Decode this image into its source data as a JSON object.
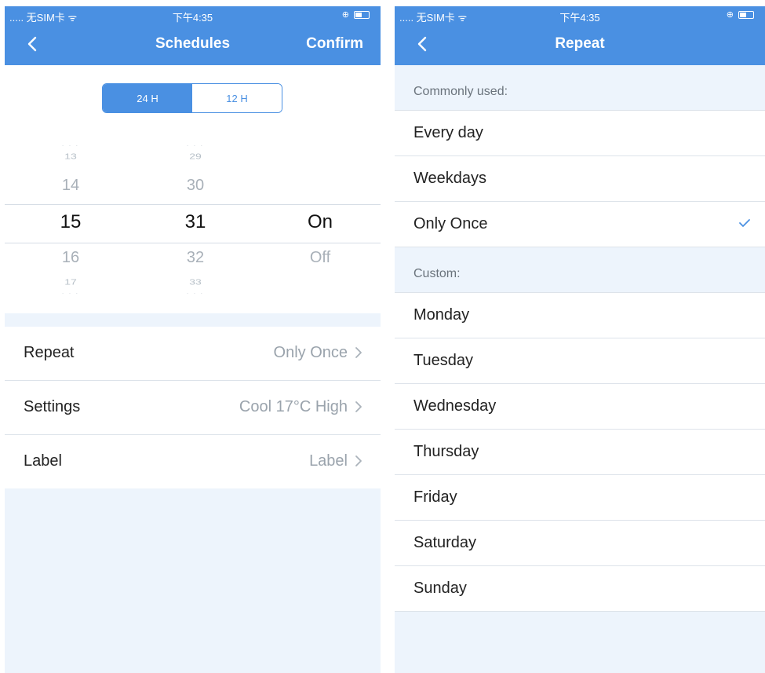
{
  "left": {
    "status": {
      "carrier": "..... 无SIM卡 ᯤ",
      "time": "下午4:35"
    },
    "nav": {
      "title": "Schedules",
      "confirm": "Confirm"
    },
    "mode_toggle": {
      "option_24": "24 H",
      "option_12": "12 H",
      "selected": "24 H"
    },
    "hours": {
      "far_above": "13",
      "above": "14",
      "selected": "15",
      "below": "16",
      "far_below": "17"
    },
    "minutes": {
      "far_above": "29",
      "above": "30",
      "selected": "31",
      "below": "32",
      "far_below": "33"
    },
    "state": {
      "selected": "On",
      "below": "Off"
    },
    "rows": [
      {
        "label": "Repeat",
        "value": "Only Once"
      },
      {
        "label": "Settings",
        "value": "Cool 17°C High"
      },
      {
        "label": "Label",
        "value": "Label"
      }
    ]
  },
  "right": {
    "status": {
      "carrier": "..... 无SIM卡 ᯤ",
      "time": "下午4:35"
    },
    "nav": {
      "title": "Repeat"
    },
    "common_header": "Commonly used:",
    "common": [
      "Every day",
      "Weekdays",
      "Only Once"
    ],
    "selected": "Only Once",
    "custom_header": "Custom:",
    "custom": [
      "Monday",
      "Tuesday",
      "Wednesday",
      "Thursday",
      "Friday",
      "Saturday",
      "Sunday"
    ]
  },
  "colors": {
    "accent": "#4a90e2",
    "background": "#edf4fc"
  }
}
